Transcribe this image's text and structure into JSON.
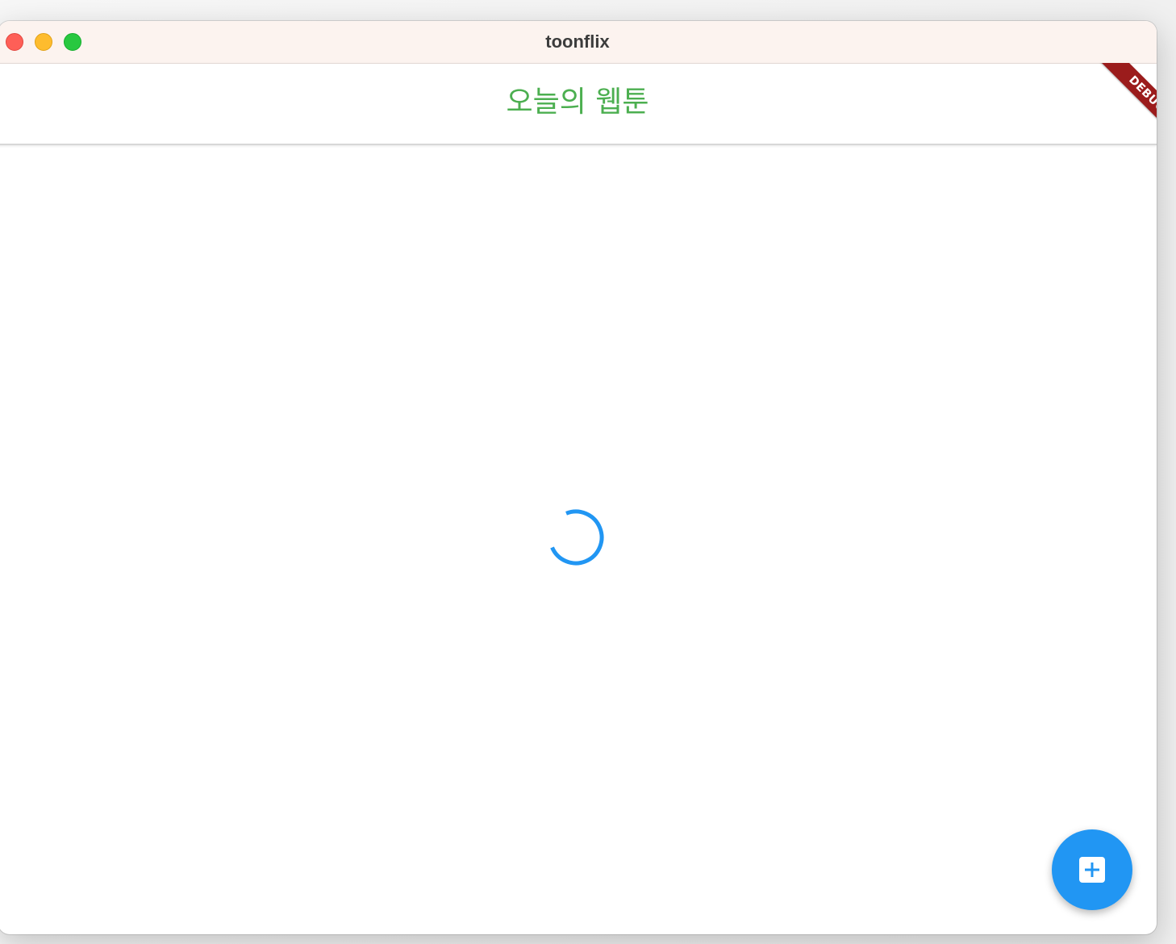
{
  "window": {
    "title": "toonflix",
    "controls": [
      "close",
      "minimize",
      "maximize"
    ]
  },
  "appbar": {
    "title": "오늘의 웹툰",
    "title_color": "#4caf50"
  },
  "debug_banner": {
    "label": "DEBUG",
    "color": "#9b1c1c"
  },
  "body": {
    "loading_indicator": "circular-progress",
    "accent_color": "#2196f3"
  },
  "fab": {
    "icon": "add-box-icon",
    "color": "#2196f3"
  }
}
